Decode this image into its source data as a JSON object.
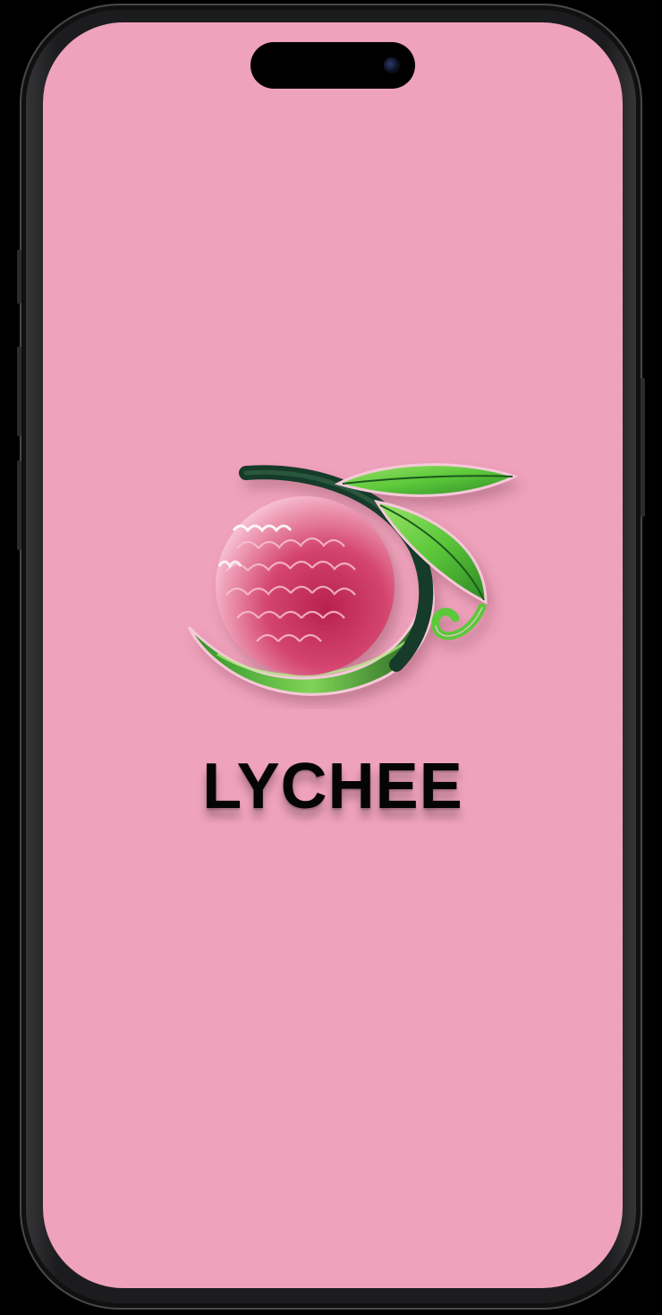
{
  "splash": {
    "app_name": "LYCHEE",
    "logo_icon": "lychee-fruit-logo"
  },
  "colors": {
    "background": "#efa2bc",
    "title": "#050505",
    "fruit": "#c8365f",
    "leaf": "#5cc83a",
    "device_frame": "#1c1c1e"
  }
}
